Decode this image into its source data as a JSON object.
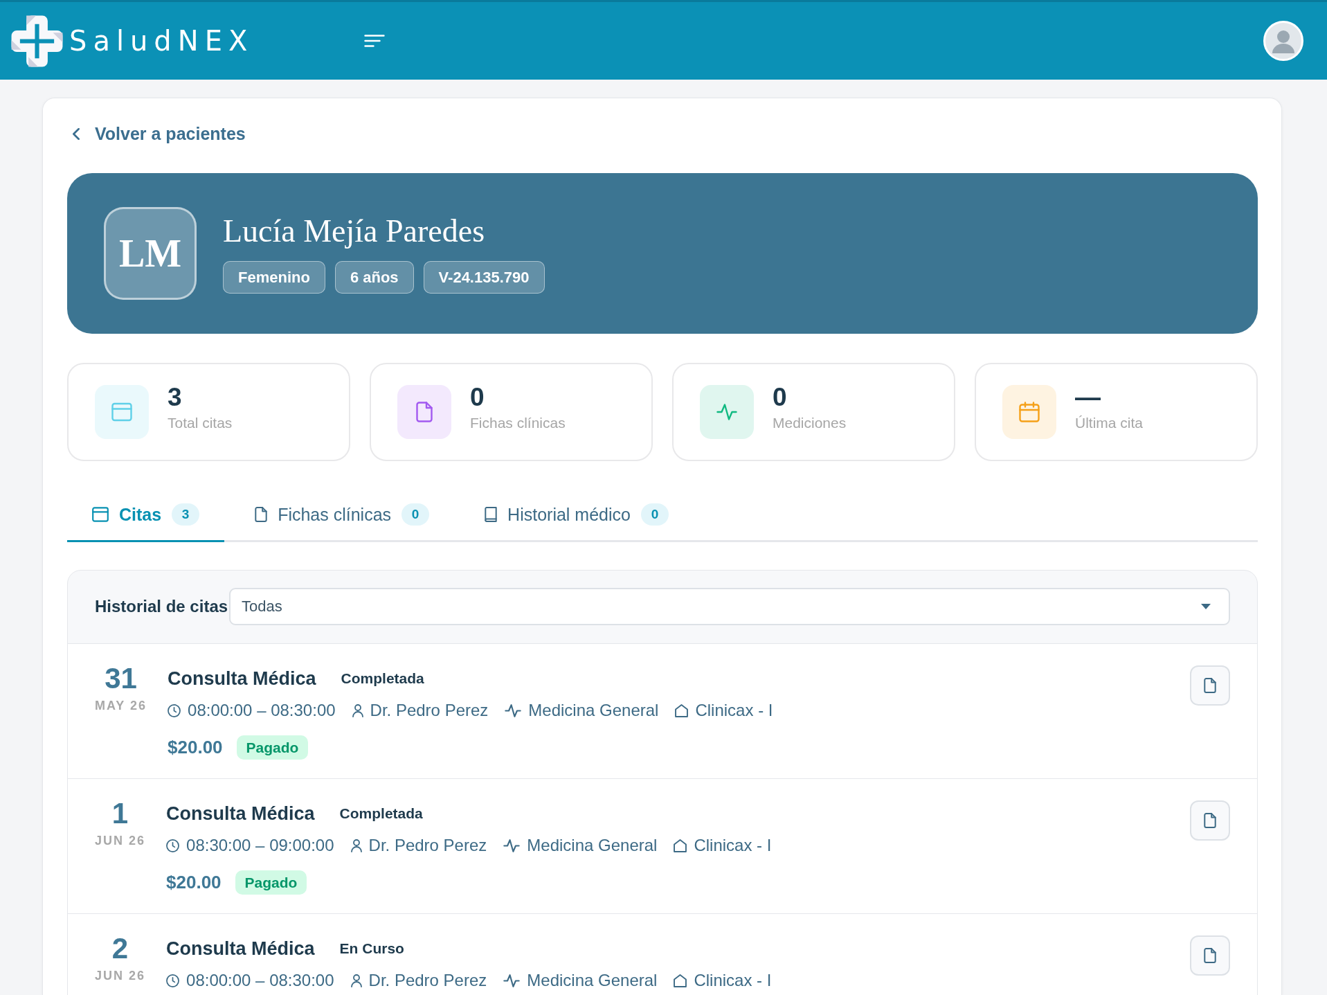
{
  "header": {
    "logo_text": "SaludNEX"
  },
  "back_link": {
    "label": "Volver a pacientes"
  },
  "patient": {
    "initials": "LM",
    "name": "Lucía Mejía Paredes",
    "tags": [
      "Femenino",
      "6 años",
      "V-24.135.790"
    ]
  },
  "stats": [
    {
      "kind": "total",
      "value": "3",
      "label": "Total citas",
      "color": "#5fd0e8"
    },
    {
      "kind": "records",
      "value": "0",
      "label": "Fichas clínicas",
      "color": "#a259f0"
    },
    {
      "kind": "measurements",
      "value": "0",
      "label": "Mediciones",
      "color": "#10b981"
    },
    {
      "kind": "last",
      "value": "—",
      "label": "Última cita",
      "color": "#f5a018"
    }
  ],
  "tabs": [
    {
      "kind": "appointments",
      "label": "Citas",
      "count": "3",
      "selected": true
    },
    {
      "kind": "records",
      "label": "Fichas clínicas",
      "count": "0",
      "selected": false
    },
    {
      "kind": "history",
      "label": "Historial médico",
      "count": "0",
      "selected": false
    }
  ],
  "appointments_panel": {
    "title": "Historial de citas",
    "filter": {
      "value": "Todas"
    },
    "appointments": [
      {
        "day": "31",
        "month_year": "MAY 26",
        "title": "Consulta Médica",
        "status": "Completada",
        "time": "08:00:00 – 08:30:00",
        "doctor": "Dr. Pedro Perez",
        "specialty": "Medicina General",
        "location": "Clinicax - I",
        "price": "$20.00",
        "payment_status": "Pagado"
      },
      {
        "day": "1",
        "month_year": "JUN 26",
        "title": "Consulta Médica",
        "status": "Completada",
        "time": "08:30:00 – 09:00:00",
        "doctor": "Dr. Pedro Perez",
        "specialty": "Medicina General",
        "location": "Clinicax - I",
        "price": "$20.00",
        "payment_status": "Pagado"
      },
      {
        "day": "2",
        "month_year": "JUN 26",
        "title": "Consulta Médica",
        "status": "En Curso",
        "time": "08:00:00 – 08:30:00",
        "doctor": "Dr. Pedro Perez",
        "specialty": "Medicina General",
        "location": "Clinicax - I"
      }
    ]
  }
}
